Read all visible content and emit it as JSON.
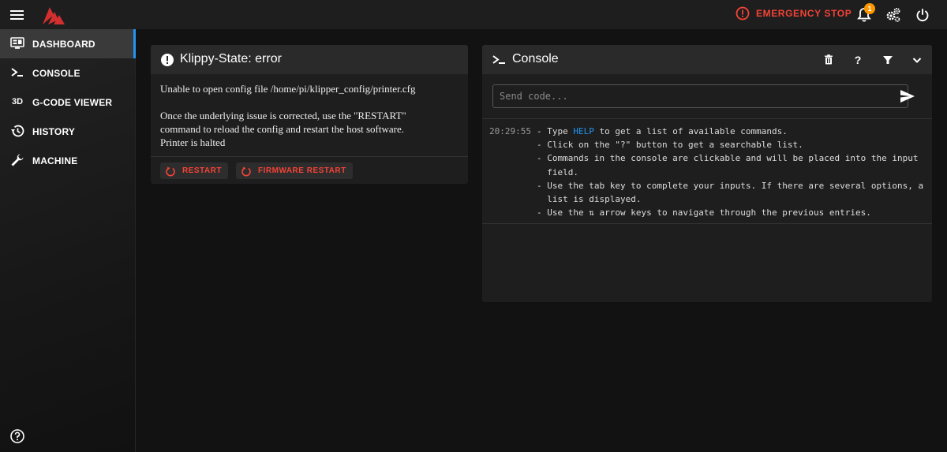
{
  "topbar": {
    "emergency_stop_label": "EMERGENCY STOP",
    "notification_count": "1"
  },
  "sidebar": {
    "items": [
      {
        "label": "DASHBOARD",
        "icon": "monitor-dashboard-icon",
        "active": true
      },
      {
        "label": "CONSOLE",
        "icon": "console-icon"
      },
      {
        "label": "G-CODE VIEWER",
        "icon": "3d-icon",
        "icon_text": "3D"
      },
      {
        "label": "HISTORY",
        "icon": "history-icon"
      },
      {
        "label": "MACHINE",
        "icon": "wrench-icon"
      }
    ]
  },
  "klippy": {
    "title": "Klippy-State: error",
    "message": "Unable to open config file /home/pi/klipper_config/printer.cfg",
    "hint_line1": "Once the underlying issue is corrected, use the \"RESTART\"",
    "hint_line2": "command to reload the config and restart the host software.",
    "hint_line3": "Printer is halted",
    "restart_label": "RESTART",
    "firmware_restart_label": "FIRMWARE RESTART"
  },
  "console": {
    "title": "Console",
    "placeholder": "Send code...",
    "help_label": "?",
    "entries": {
      "timestamp": "20:29:55",
      "line1_a": "- Type ",
      "line1_cmd": "HELP",
      "line1_b": " to get a list of available commands.",
      "line2": "- Click on the \"?\" button to get a searchable list.",
      "line3": "- Commands in the console are clickable and will be placed into the input",
      "line4": "  field.",
      "line5": "- Use the tab key to complete your inputs. If there are several options, a",
      "line6": "  list is displayed.",
      "line7": "- Use the ⇅ arrow keys to navigate through the previous entries."
    }
  },
  "colors": {
    "accent": "#2196f3",
    "danger": "#f44336",
    "badge": "#ff9800",
    "logo": "#d32f2f"
  }
}
